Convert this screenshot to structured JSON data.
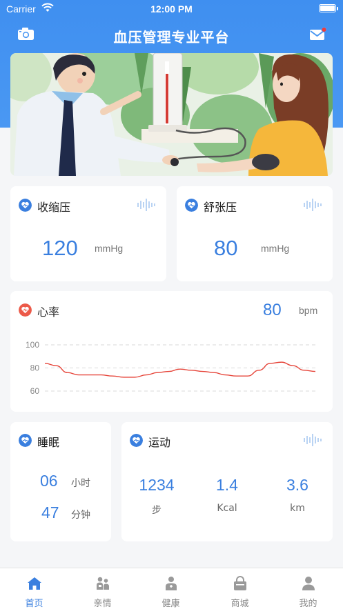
{
  "status_bar": {
    "carrier": "Carrier",
    "time": "12:00 PM"
  },
  "nav": {
    "title": "血压管理专业平台"
  },
  "systolic": {
    "title": "收缩压",
    "value": "120",
    "unit": "mmHg"
  },
  "diastolic": {
    "title": "舒张压",
    "value": "80",
    "unit": "mmHg"
  },
  "heart_rate": {
    "title": "心率",
    "value": "80",
    "unit": "bpm"
  },
  "chart_data": {
    "type": "line",
    "title": "",
    "xlabel": "",
    "ylabel": "",
    "ylim": [
      60,
      100
    ],
    "y_ticks": [
      "100",
      "80",
      "60"
    ],
    "grid": true,
    "series": [
      {
        "values": [
          84,
          82,
          76,
          74,
          74,
          74,
          73,
          72,
          72,
          74,
          76,
          77,
          79,
          78,
          77,
          76,
          74,
          73,
          73,
          78,
          84,
          85,
          82,
          78,
          77
        ]
      }
    ],
    "line_color": "#e6453a"
  },
  "sleep": {
    "title": "睡眠",
    "hours": "06",
    "hours_unit": "小时",
    "minutes": "47",
    "minutes_unit": "分钟"
  },
  "exercise": {
    "title": "运动",
    "stats": [
      {
        "value": "1234",
        "label": "步"
      },
      {
        "value": "1.4",
        "label": "Kcal"
      },
      {
        "value": "3.6",
        "label": "km"
      }
    ]
  },
  "tabs": [
    {
      "label": "首页",
      "icon": "home-icon",
      "active": true
    },
    {
      "label": "亲情",
      "icon": "family-icon",
      "active": false
    },
    {
      "label": "健康",
      "icon": "health-icon",
      "active": false
    },
    {
      "label": "商城",
      "icon": "shop-icon",
      "active": false
    },
    {
      "label": "我的",
      "icon": "user-icon",
      "active": false
    }
  ],
  "colors": {
    "accent": "#3a7fdf",
    "header": "#4a98f3",
    "heart_icon": "#ec5a49"
  }
}
